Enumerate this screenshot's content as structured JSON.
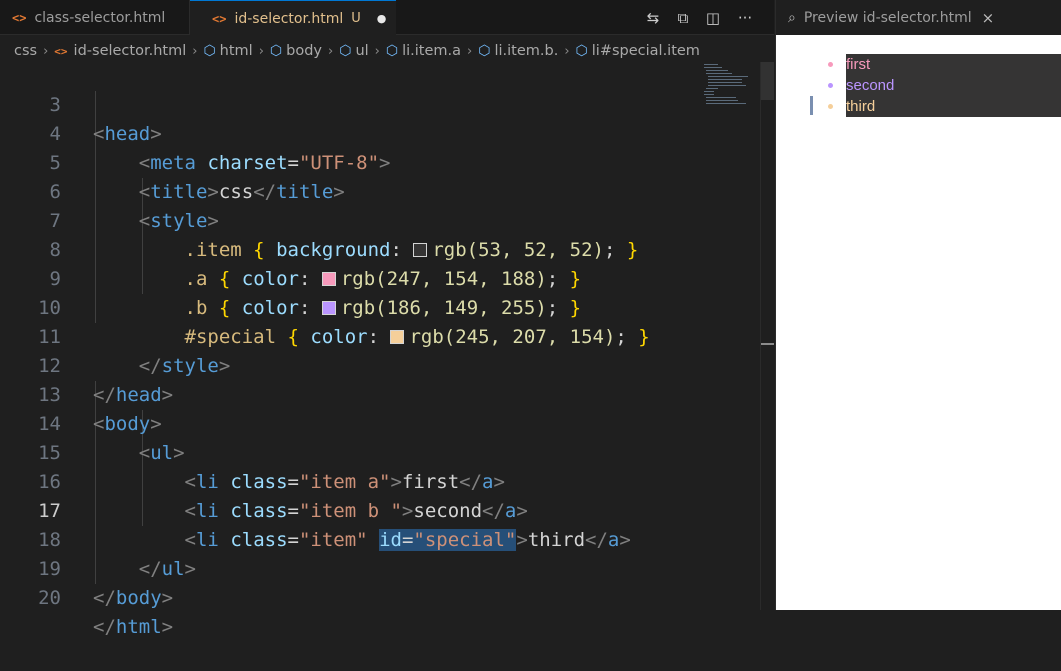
{
  "tabs": {
    "tab1": {
      "icon": "<>",
      "label": "class-selector.html"
    },
    "tab2": {
      "icon": "<>",
      "label": "id-selector.html",
      "badge": "U",
      "dirty": "●"
    }
  },
  "actions": {
    "compare": "⇆",
    "open_preview": "⧉",
    "split": "◫",
    "more": "···"
  },
  "breadcrumb": [
    "css",
    "id-selector.html",
    "html",
    "body",
    "ul",
    "li.item.a",
    "li.item.b.",
    "li#special.item"
  ],
  "code": {
    "line_numbers": [
      "3",
      "4",
      "5",
      "6",
      "7",
      "8",
      "9",
      "10",
      "11",
      "12",
      "13",
      "14",
      "15",
      "16",
      "17",
      "18",
      "19",
      "20"
    ],
    "current_line": "17",
    "colors": {
      "item_bg": "rgb(53, 52, 52)",
      "a_color": "rgb(247, 154, 188)",
      "b_color": "rgb(186, 149, 255)",
      "special_color": "rgb(245, 207, 154)"
    }
  },
  "preview": {
    "tab_label": "Preview id-selector.html",
    "close": "×",
    "items": [
      {
        "text": "first",
        "color": "#f79abc"
      },
      {
        "text": "second",
        "color": "#ba95ff"
      },
      {
        "text": "third",
        "color": "#f5cf9a"
      }
    ]
  }
}
